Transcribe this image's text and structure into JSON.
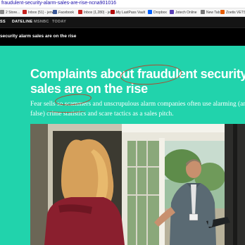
{
  "browser": {
    "url": "fraudulent-security-alarm-sales-are-rise-ncna901016",
    "bookmarks": [
      {
        "label": "2 Store...",
        "color": "#888888"
      },
      {
        "label": "Inbox (51) - jenw0...",
        "color": "#c5221f"
      },
      {
        "label": "Facebook",
        "color": "#3b5998"
      },
      {
        "label": "Inbox (1,280) - jenu...",
        "color": "#c5221f"
      },
      {
        "label": "My LastPass Vault",
        "color": "#b40b0b"
      },
      {
        "label": "Dropbox",
        "color": "#0061ff"
      },
      {
        "label": "Jotech Online",
        "color": "#5a3fb5"
      },
      {
        "label": "New Tab",
        "color": "#777777"
      },
      {
        "label": "Zoetis VETSCAN F...",
        "color": "#e65c00"
      }
    ]
  },
  "nav": {
    "items": [
      {
        "label": "SS",
        "color": "#ffffff"
      },
      {
        "label": "DATELINE",
        "color": "#ffffff"
      },
      {
        "label": "MSNBC",
        "color": "#9a9a9a"
      },
      {
        "label": "TODAY",
        "color": "#9a9a9a"
      }
    ]
  },
  "ticker": {
    "text": "security alarm sales are on the rise"
  },
  "article": {
    "headline_line1_pre": "Complaints about ",
    "headline_keyword": "fraudulent",
    "headline_line1_post": " security alarm",
    "headline_line2": "sales are on the rise",
    "dek_line1_pre": "Fear sells so ",
    "dek_keyword": "scammers",
    "dek_line1_post": " and unscrupulous alarm companies often use alarming (and some",
    "dek_line2_pre": "false) ",
    "dek_keyword2": "crime statistics",
    "dek_line2_post": " and scare tactics as a sales pitch."
  },
  "colors": {
    "hero_bg": "#21d3ac",
    "annotation_ink": "#b1482f",
    "nav_bg": "#141414"
  }
}
